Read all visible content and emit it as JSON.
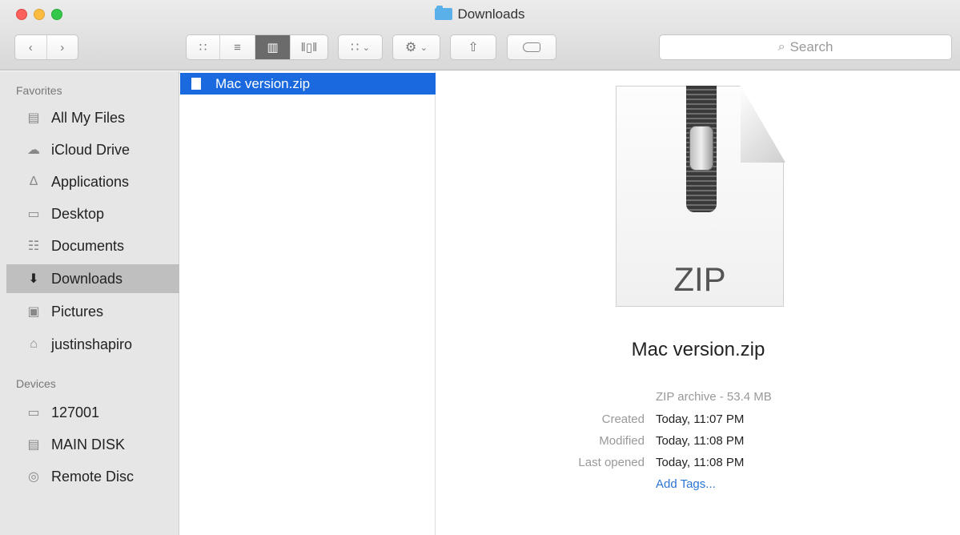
{
  "window": {
    "title": "Downloads",
    "accent": "#1a69de",
    "close_color": "#fc605b",
    "minimize_color": "#fdbc40",
    "maximize_color": "#34c84a"
  },
  "toolbar": {
    "back_icon": "chevron-left-icon",
    "forward_icon": "chevron-right-icon",
    "view_modes": [
      "icon-view",
      "list-view",
      "column-view",
      "cover-flow-view"
    ],
    "active_view": "column-view",
    "search_placeholder": "Search"
  },
  "sidebar": {
    "favorites_heading": "Favorites",
    "favorites": [
      {
        "label": "All My Files",
        "icon": "all-files-icon"
      },
      {
        "label": "iCloud Drive",
        "icon": "cloud-icon"
      },
      {
        "label": "Applications",
        "icon": "applications-icon"
      },
      {
        "label": "Desktop",
        "icon": "desktop-icon"
      },
      {
        "label": "Documents",
        "icon": "documents-icon"
      },
      {
        "label": "Downloads",
        "icon": "downloads-icon",
        "selected": true
      },
      {
        "label": "Pictures",
        "icon": "camera-icon"
      },
      {
        "label": "justinshapiro",
        "icon": "home-icon"
      }
    ],
    "devices_heading": "Devices",
    "devices": [
      {
        "label": "127001",
        "icon": "laptop-icon"
      },
      {
        "label": "MAIN DISK",
        "icon": "disk-icon"
      },
      {
        "label": "Remote Disc",
        "icon": "optical-disc-icon"
      }
    ]
  },
  "column": {
    "selected_file": "Mac version.zip"
  },
  "preview": {
    "icon_label": "ZIP",
    "name": "Mac version.zip",
    "kind": "ZIP archive - 53.4 MB",
    "created_label": "Created",
    "created_value": "Today, 11:07 PM",
    "modified_label": "Modified",
    "modified_value": "Today, 11:08 PM",
    "last_opened_label": "Last opened",
    "last_opened_value": "Today, 11:08 PM",
    "add_tags": "Add Tags..."
  }
}
